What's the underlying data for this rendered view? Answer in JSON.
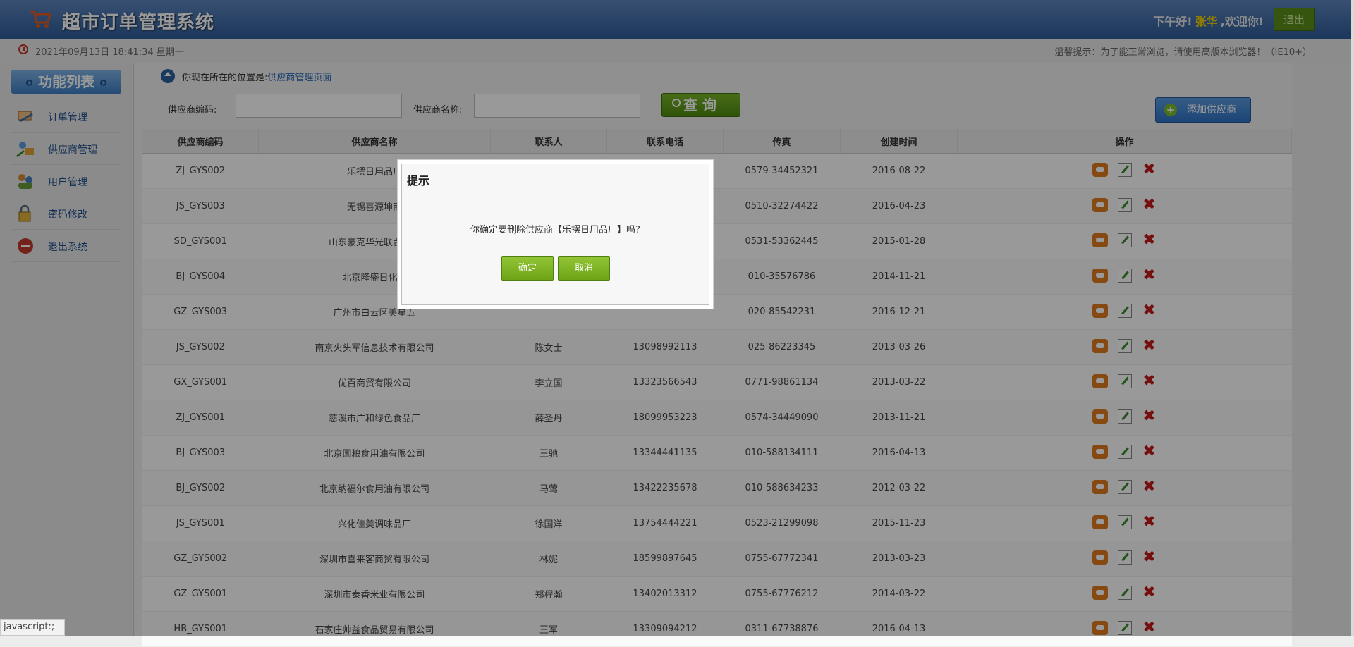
{
  "header": {
    "title": "超市订单管理系统",
    "greeting_prefix": "下午好!",
    "user_name": "张华",
    "greeting_suffix": ",欢迎你!",
    "logout_label": "退出"
  },
  "timebar": {
    "datetime": "2021年09月13日 18:41:34 星期一",
    "tip": "温馨提示：为了能正常浏览，请使用高版本浏览器！（IE10+）"
  },
  "sidebar": {
    "title": "功能列表",
    "items": [
      {
        "label": "订单管理",
        "icon": "order-icon"
      },
      {
        "label": "供应商管理",
        "icon": "supplier-icon"
      },
      {
        "label": "用户管理",
        "icon": "users-icon"
      },
      {
        "label": "密码修改",
        "icon": "lock-icon"
      },
      {
        "label": "退出系统",
        "icon": "exit-icon"
      }
    ]
  },
  "breadcrumb": {
    "prefix": "你现在所在的位置是:",
    "current": "供应商管理页面"
  },
  "search": {
    "code_label": "供应商编码:",
    "code_value": "",
    "name_label": "供应商名称:",
    "name_value": "",
    "query_label": "查 询",
    "add_label": "添加供应商"
  },
  "table": {
    "headers": [
      "供应商编码",
      "供应商名称",
      "联系人",
      "联系电话",
      "传真",
      "创建时间",
      "操作"
    ],
    "rows": [
      {
        "code": "ZJ_GYS002",
        "name": "乐摆日用品厂",
        "contact": "",
        "phone": "",
        "fax": "0579-34452321",
        "date": "2016-08-22"
      },
      {
        "code": "JS_GYS003",
        "name": "无锡喜源坤商",
        "contact": "",
        "phone": "",
        "fax": "0510-32274422",
        "date": "2016-04-23"
      },
      {
        "code": "SD_GYS001",
        "name": "山东豪克华光联合发展",
        "contact": "",
        "phone": "",
        "fax": "0531-53362445",
        "date": "2015-01-28"
      },
      {
        "code": "BJ_GYS004",
        "name": "北京隆盛日化科",
        "contact": "",
        "phone": "",
        "fax": "010-35576786",
        "date": "2014-11-21"
      },
      {
        "code": "GZ_GYS003",
        "name": "广州市白云区美星五",
        "contact": "",
        "phone": "",
        "fax": "020-85542231",
        "date": "2016-12-21"
      },
      {
        "code": "JS_GYS002",
        "name": "南京火头军信息技术有限公司",
        "contact": "陈女士",
        "phone": "13098992113",
        "fax": "025-86223345",
        "date": "2013-03-26"
      },
      {
        "code": "GX_GYS001",
        "name": "优百商贸有限公司",
        "contact": "李立国",
        "phone": "13323566543",
        "fax": "0771-98861134",
        "date": "2013-03-22"
      },
      {
        "code": "ZJ_GYS001",
        "name": "慈溪市广和绿色食品厂",
        "contact": "薛圣丹",
        "phone": "18099953223",
        "fax": "0574-34449090",
        "date": "2013-11-21"
      },
      {
        "code": "BJ_GYS003",
        "name": "北京国粮食用油有限公司",
        "contact": "王驰",
        "phone": "13344441135",
        "fax": "010-588134111",
        "date": "2016-04-13"
      },
      {
        "code": "BJ_GYS002",
        "name": "北京纳福尔食用油有限公司",
        "contact": "马莺",
        "phone": "13422235678",
        "fax": "010-588634233",
        "date": "2012-03-22"
      },
      {
        "code": "JS_GYS001",
        "name": "兴化佳美调味品厂",
        "contact": "徐国洋",
        "phone": "13754444221",
        "fax": "0523-21299098",
        "date": "2015-11-23"
      },
      {
        "code": "GZ_GYS002",
        "name": "深圳市喜来客商贸有限公司",
        "contact": "林妮",
        "phone": "18599897645",
        "fax": "0755-67772341",
        "date": "2013-03-23"
      },
      {
        "code": "GZ_GYS001",
        "name": "深圳市泰香米业有限公司",
        "contact": "郑程瀚",
        "phone": "13402013312",
        "fax": "0755-67776212",
        "date": "2014-03-22"
      },
      {
        "code": "HB_GYS001",
        "name": "石家庄帅益食品贸易有限公司",
        "contact": "王军",
        "phone": "13309094212",
        "fax": "0311-67738876",
        "date": "2016-04-13"
      }
    ]
  },
  "dialog": {
    "title": "提示",
    "message": "你确定要删除供应商【乐摆日用品厂】吗?",
    "confirm_label": "确定",
    "cancel_label": "取消"
  },
  "status_bar": {
    "text": "javascript:;"
  },
  "colors": {
    "header_blue": "#2f5c98",
    "accent_green": "#6ea316",
    "delete_red": "#c51b1b",
    "view_orange": "#e07a1f"
  }
}
